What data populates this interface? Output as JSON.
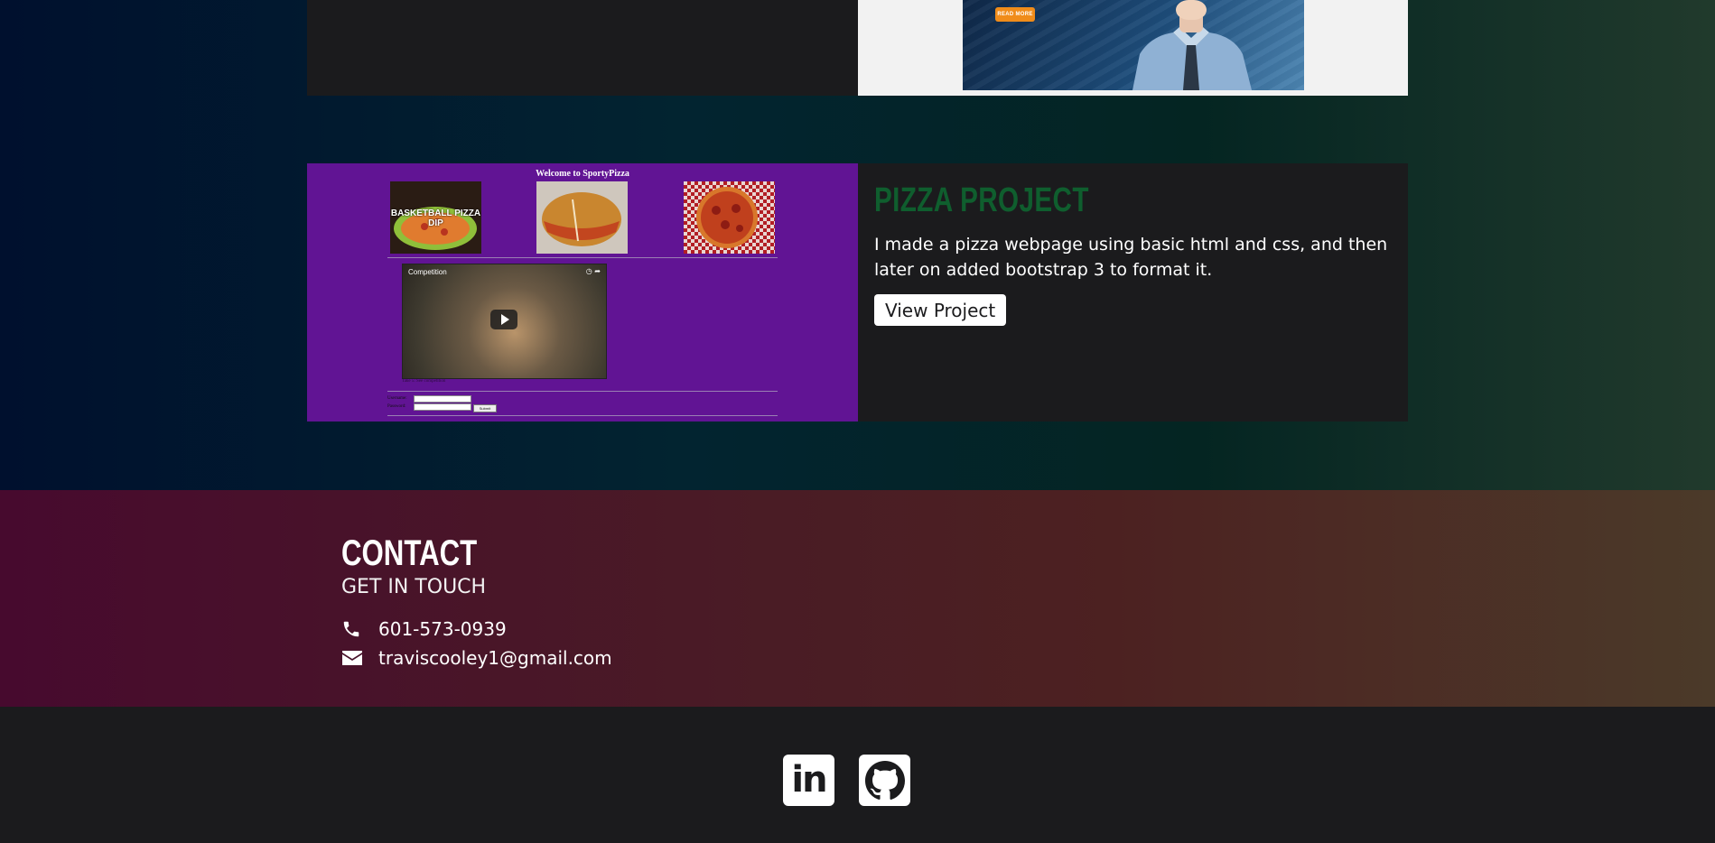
{
  "top_card": {
    "read_more_label": "READ MORE"
  },
  "pizza_card": {
    "screenshot": {
      "title": "Welcome to SportyPizza",
      "thumb1_text": "BASKETBALL PIZZA DIP",
      "video_title": "Competition",
      "caption": "Take 5: See competition",
      "form_label_1": "Username:",
      "form_label_2": "Password:",
      "submit_label": "Submit"
    },
    "title": "PIZZA PROJECT",
    "description": "I made a pizza webpage using basic html and css, and then later on added bootstrap 3 to format it.",
    "button_label": "View Project"
  },
  "contact": {
    "title": "CONTACT",
    "subtitle": "GET IN TOUCH",
    "phone": "601-573-0939",
    "email": "traviscooley1@gmail.com",
    "phone_icon": "phone-icon",
    "email_icon": "envelope-icon"
  },
  "footer": {
    "links": [
      {
        "icon": "linkedin-icon",
        "label": "in"
      },
      {
        "icon": "github-icon"
      }
    ]
  },
  "colors": {
    "project_title": "#0f5e2e",
    "pizza_bg": "#611494",
    "card_bg": "#1b1b1d",
    "read_more": "#f08c1a"
  }
}
